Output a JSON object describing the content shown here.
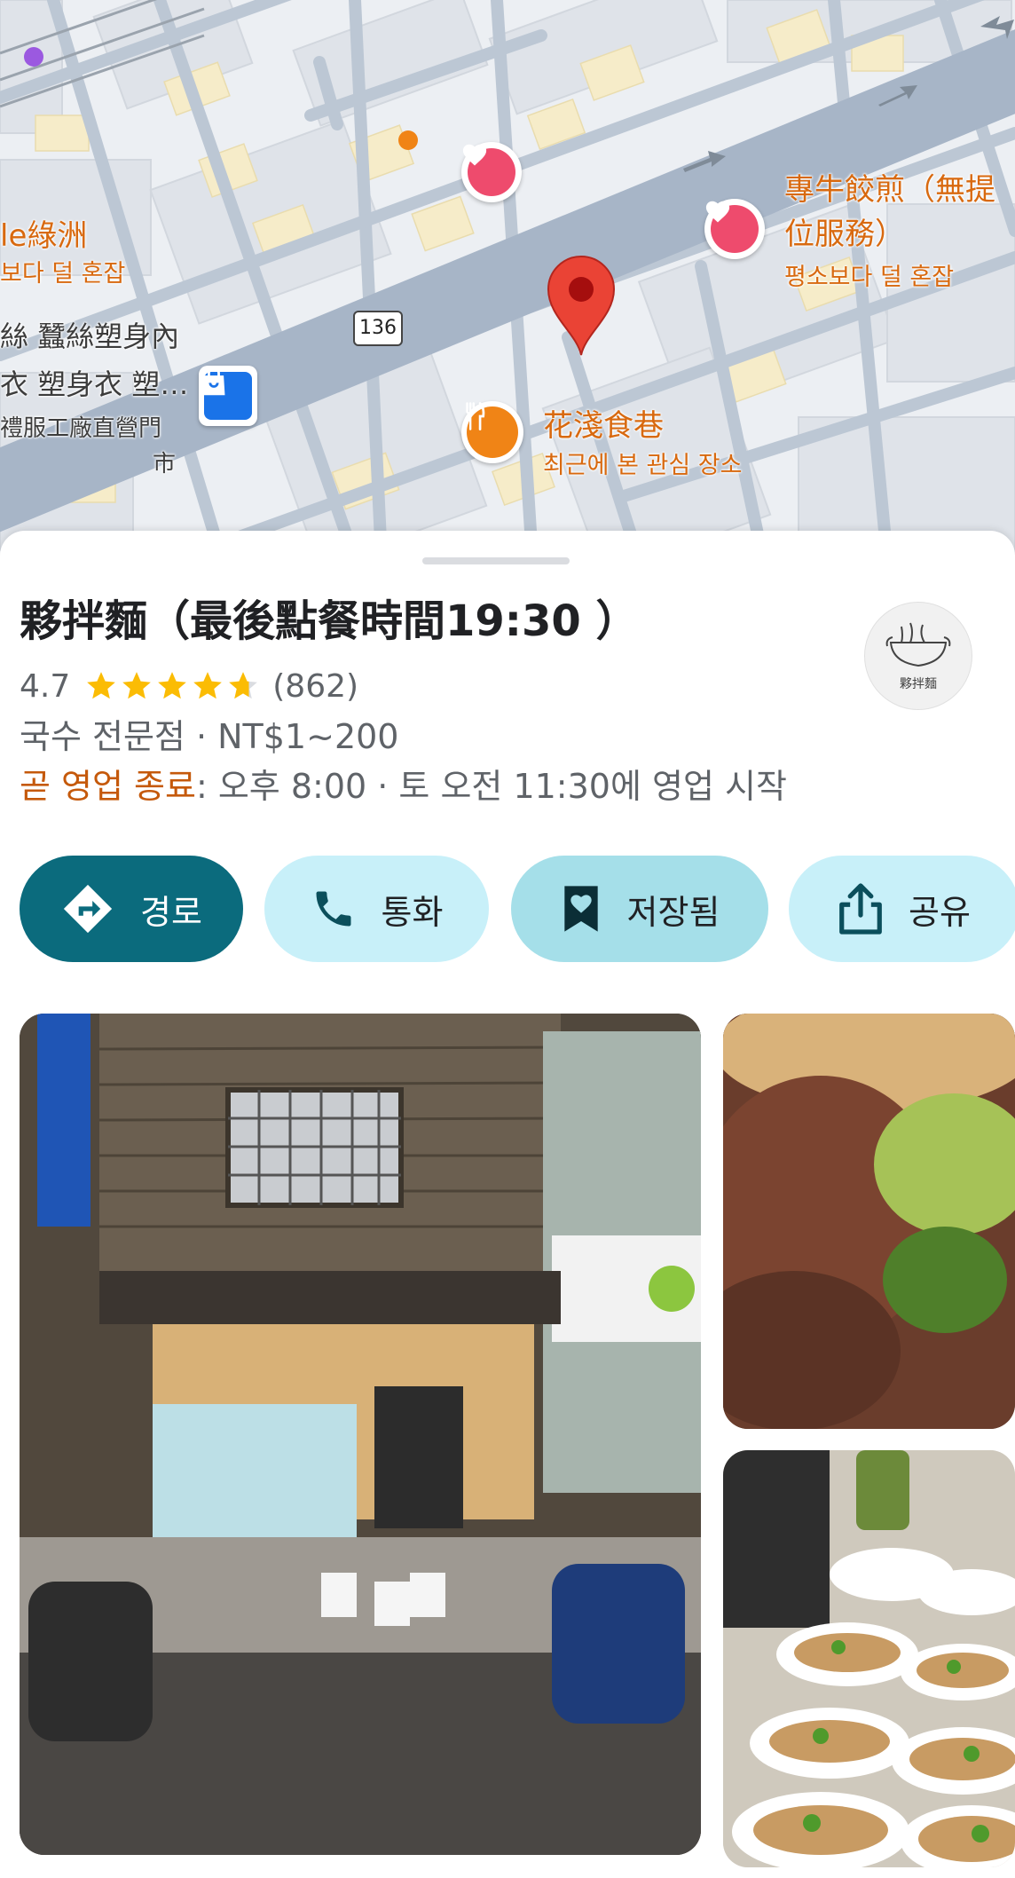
{
  "map": {
    "route_number": "136",
    "labels": {
      "oasis_name": "le綠洲",
      "oasis_busy": "보다 덜 혼잡",
      "shop_line1": "絲 蠶絲塑身內",
      "shop_line2": "衣 塑身衣 塑…",
      "shop_line3": "禮服工廠直營門",
      "shop_line4": "市",
      "dumpling_line1": "專牛餃煎（無提",
      "dumpling_line2": "位服務）",
      "dumpling_busy": "평소보다 덜 혼잡",
      "food_alley_name": "花淺食巷",
      "food_alley_note": "최근에 본 관심 장소"
    },
    "icons": [
      "heart-icon",
      "shopping-bag-icon",
      "fork-knife-icon",
      "location-pin-icon"
    ],
    "colors": {
      "road": "#a7b5c7",
      "water": "#ffffff",
      "pin_red": "#ea4335",
      "heart": "#ee4b6d",
      "food": "#f08416",
      "shop": "#1a73e8"
    }
  },
  "place": {
    "title": "夥拌麵（最後點餐時間19:30 ）",
    "rating": "4.7",
    "rating_value": 4.7,
    "review_count": "(862)",
    "category": "국수 전문점 · NT$1~200",
    "closing_status": "곧 영업 종료",
    "hours_detail": ": 오후 8:00 · 토 오전 11:30에 영업 시작",
    "logo_text": "夥拌麵"
  },
  "actions": {
    "route_label": "경로",
    "call_label": "통화",
    "saved_label": "저장됨",
    "share_label": "공유"
  },
  "colors": {
    "primary_button": "#0b6b7d",
    "tonal_button": "#c8f0f9",
    "saved_button": "#a5dfe9",
    "star": "#fbbc04",
    "closing": "#c5590b"
  }
}
